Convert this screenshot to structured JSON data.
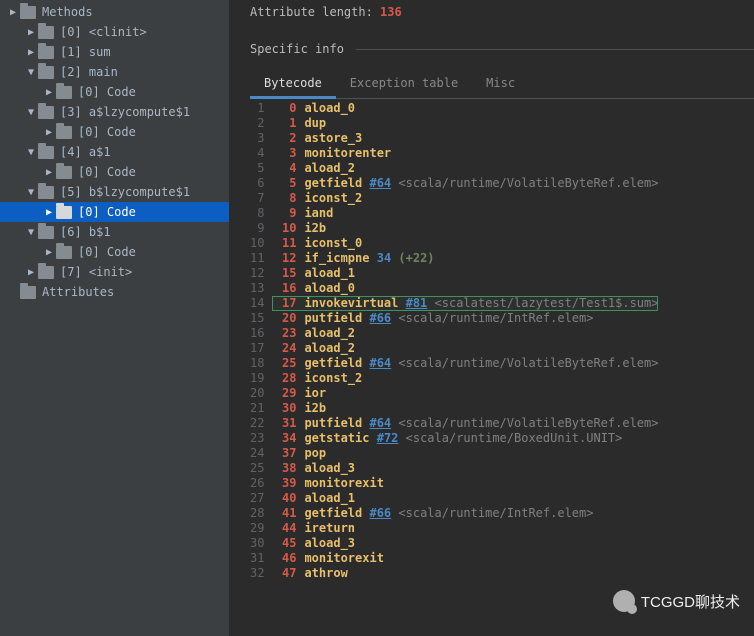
{
  "sidebar": {
    "items": [
      {
        "indent": 0,
        "arrow": "▶",
        "label": "Methods"
      },
      {
        "indent": 1,
        "arrow": "▶",
        "label": "[0] <clinit>"
      },
      {
        "indent": 1,
        "arrow": "▶",
        "label": "[1] sum"
      },
      {
        "indent": 1,
        "arrow": "▼",
        "label": "[2] main"
      },
      {
        "indent": 2,
        "arrow": "▶",
        "label": "[0] Code"
      },
      {
        "indent": 1,
        "arrow": "▼",
        "label": "[3] a$lzycompute$1"
      },
      {
        "indent": 2,
        "arrow": "▶",
        "label": "[0] Code"
      },
      {
        "indent": 1,
        "arrow": "▼",
        "label": "[4] a$1"
      },
      {
        "indent": 2,
        "arrow": "▶",
        "label": "[0] Code"
      },
      {
        "indent": 1,
        "arrow": "▼",
        "label": "[5] b$lzycompute$1"
      },
      {
        "indent": 2,
        "arrow": "▶",
        "label": "[0] Code",
        "selected": true
      },
      {
        "indent": 1,
        "arrow": "▼",
        "label": "[6] b$1"
      },
      {
        "indent": 2,
        "arrow": "▶",
        "label": "[0] Code"
      },
      {
        "indent": 1,
        "arrow": "▶",
        "label": "[7] <init>"
      },
      {
        "indent": 0,
        "arrow": "",
        "label": "Attributes"
      }
    ]
  },
  "header": {
    "attr_label": "Attribute length:",
    "attr_value": "136",
    "section": "Specific info"
  },
  "tabs": [
    {
      "label": "Bytecode",
      "active": true
    },
    {
      "label": "Exception table",
      "active": false
    },
    {
      "label": "Misc",
      "active": false
    }
  ],
  "bytecode": [
    {
      "ln": 1,
      "pc": "0",
      "op": "aload_0"
    },
    {
      "ln": 2,
      "pc": "1",
      "op": "dup"
    },
    {
      "ln": 3,
      "pc": "2",
      "op": "astore_3"
    },
    {
      "ln": 4,
      "pc": "3",
      "op": "monitorenter"
    },
    {
      "ln": 5,
      "pc": "4",
      "op": "aload_2"
    },
    {
      "ln": 6,
      "pc": "5",
      "op": "getfield",
      "ref": "#64",
      "cmt": " <scala/runtime/VolatileByteRef.elem>"
    },
    {
      "ln": 7,
      "pc": "8",
      "op": "iconst_2"
    },
    {
      "ln": 8,
      "pc": "9",
      "op": "iand"
    },
    {
      "ln": 9,
      "pc": "10",
      "op": "i2b"
    },
    {
      "ln": 10,
      "pc": "11",
      "op": "iconst_0"
    },
    {
      "ln": 11,
      "pc": "12",
      "op": "if_icmpne",
      "jump": "34",
      "delta": "(+22)"
    },
    {
      "ln": 12,
      "pc": "15",
      "op": "aload_1"
    },
    {
      "ln": 13,
      "pc": "16",
      "op": "aload_0"
    },
    {
      "ln": 14,
      "pc": "17",
      "op": "invokevirtual",
      "ref": "#81",
      "cmt": " <scalatest/lazytest/Test1$.sum>",
      "hl": true
    },
    {
      "ln": 15,
      "pc": "20",
      "op": "putfield",
      "ref": "#66",
      "cmt": " <scala/runtime/IntRef.elem>"
    },
    {
      "ln": 16,
      "pc": "23",
      "op": "aload_2"
    },
    {
      "ln": 17,
      "pc": "24",
      "op": "aload_2"
    },
    {
      "ln": 18,
      "pc": "25",
      "op": "getfield",
      "ref": "#64",
      "cmt": " <scala/runtime/VolatileByteRef.elem>"
    },
    {
      "ln": 19,
      "pc": "28",
      "op": "iconst_2"
    },
    {
      "ln": 20,
      "pc": "29",
      "op": "ior"
    },
    {
      "ln": 21,
      "pc": "30",
      "op": "i2b"
    },
    {
      "ln": 22,
      "pc": "31",
      "op": "putfield",
      "ref": "#64",
      "cmt": " <scala/runtime/VolatileByteRef.elem>"
    },
    {
      "ln": 23,
      "pc": "34",
      "op": "getstatic",
      "ref": "#72",
      "cmt": " <scala/runtime/BoxedUnit.UNIT>"
    },
    {
      "ln": 24,
      "pc": "37",
      "op": "pop"
    },
    {
      "ln": 25,
      "pc": "38",
      "op": "aload_3"
    },
    {
      "ln": 26,
      "pc": "39",
      "op": "monitorexit"
    },
    {
      "ln": 27,
      "pc": "40",
      "op": "aload_1"
    },
    {
      "ln": 28,
      "pc": "41",
      "op": "getfield",
      "ref": "#66",
      "cmt": " <scala/runtime/IntRef.elem>"
    },
    {
      "ln": 29,
      "pc": "44",
      "op": "ireturn"
    },
    {
      "ln": 30,
      "pc": "45",
      "op": "aload_3"
    },
    {
      "ln": 31,
      "pc": "46",
      "op": "monitorexit"
    },
    {
      "ln": 32,
      "pc": "47",
      "op": "athrow"
    }
  ],
  "watermark": "TCGGD聊技术"
}
